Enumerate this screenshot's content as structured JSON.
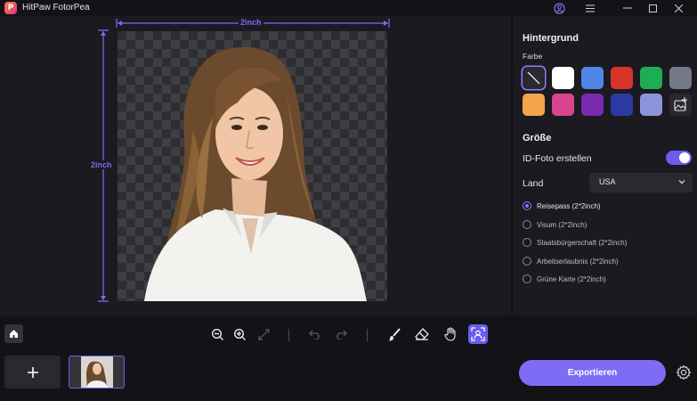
{
  "app": {
    "title": "HitPaw FotorPea",
    "logo_letter": "P"
  },
  "canvas": {
    "width_label": "2inch",
    "height_label": "2inch"
  },
  "panel": {
    "background_title": "Hintergrund",
    "color_label": "Farbe",
    "colors": [
      "none",
      "#ffffff",
      "#4f86e8",
      "#d6342a",
      "#1fad52",
      "#737987",
      "#f4a44a",
      "#d9448f",
      "#7a2ab0",
      "#2c3aa3",
      "#8c95da",
      "custom-image"
    ],
    "size_title": "Größe",
    "id_photo_label": "ID-Foto erstellen",
    "id_photo_on": true,
    "country_label": "Land",
    "country_value": "USA",
    "options": [
      {
        "label": "Reisepass (2*2inch)",
        "checked": true
      },
      {
        "label": "Visum (2*2inch)",
        "checked": false
      },
      {
        "label": "Staatsbürgerschaft (2*2inch)",
        "checked": false
      },
      {
        "label": "Arbeitserlaubnis (2*2inch)",
        "checked": false
      },
      {
        "label": "Grüne Karte (2*2inch)",
        "checked": false
      }
    ]
  },
  "bottom": {
    "export_label": "Exportieren"
  },
  "accent": "#7f6cf5"
}
